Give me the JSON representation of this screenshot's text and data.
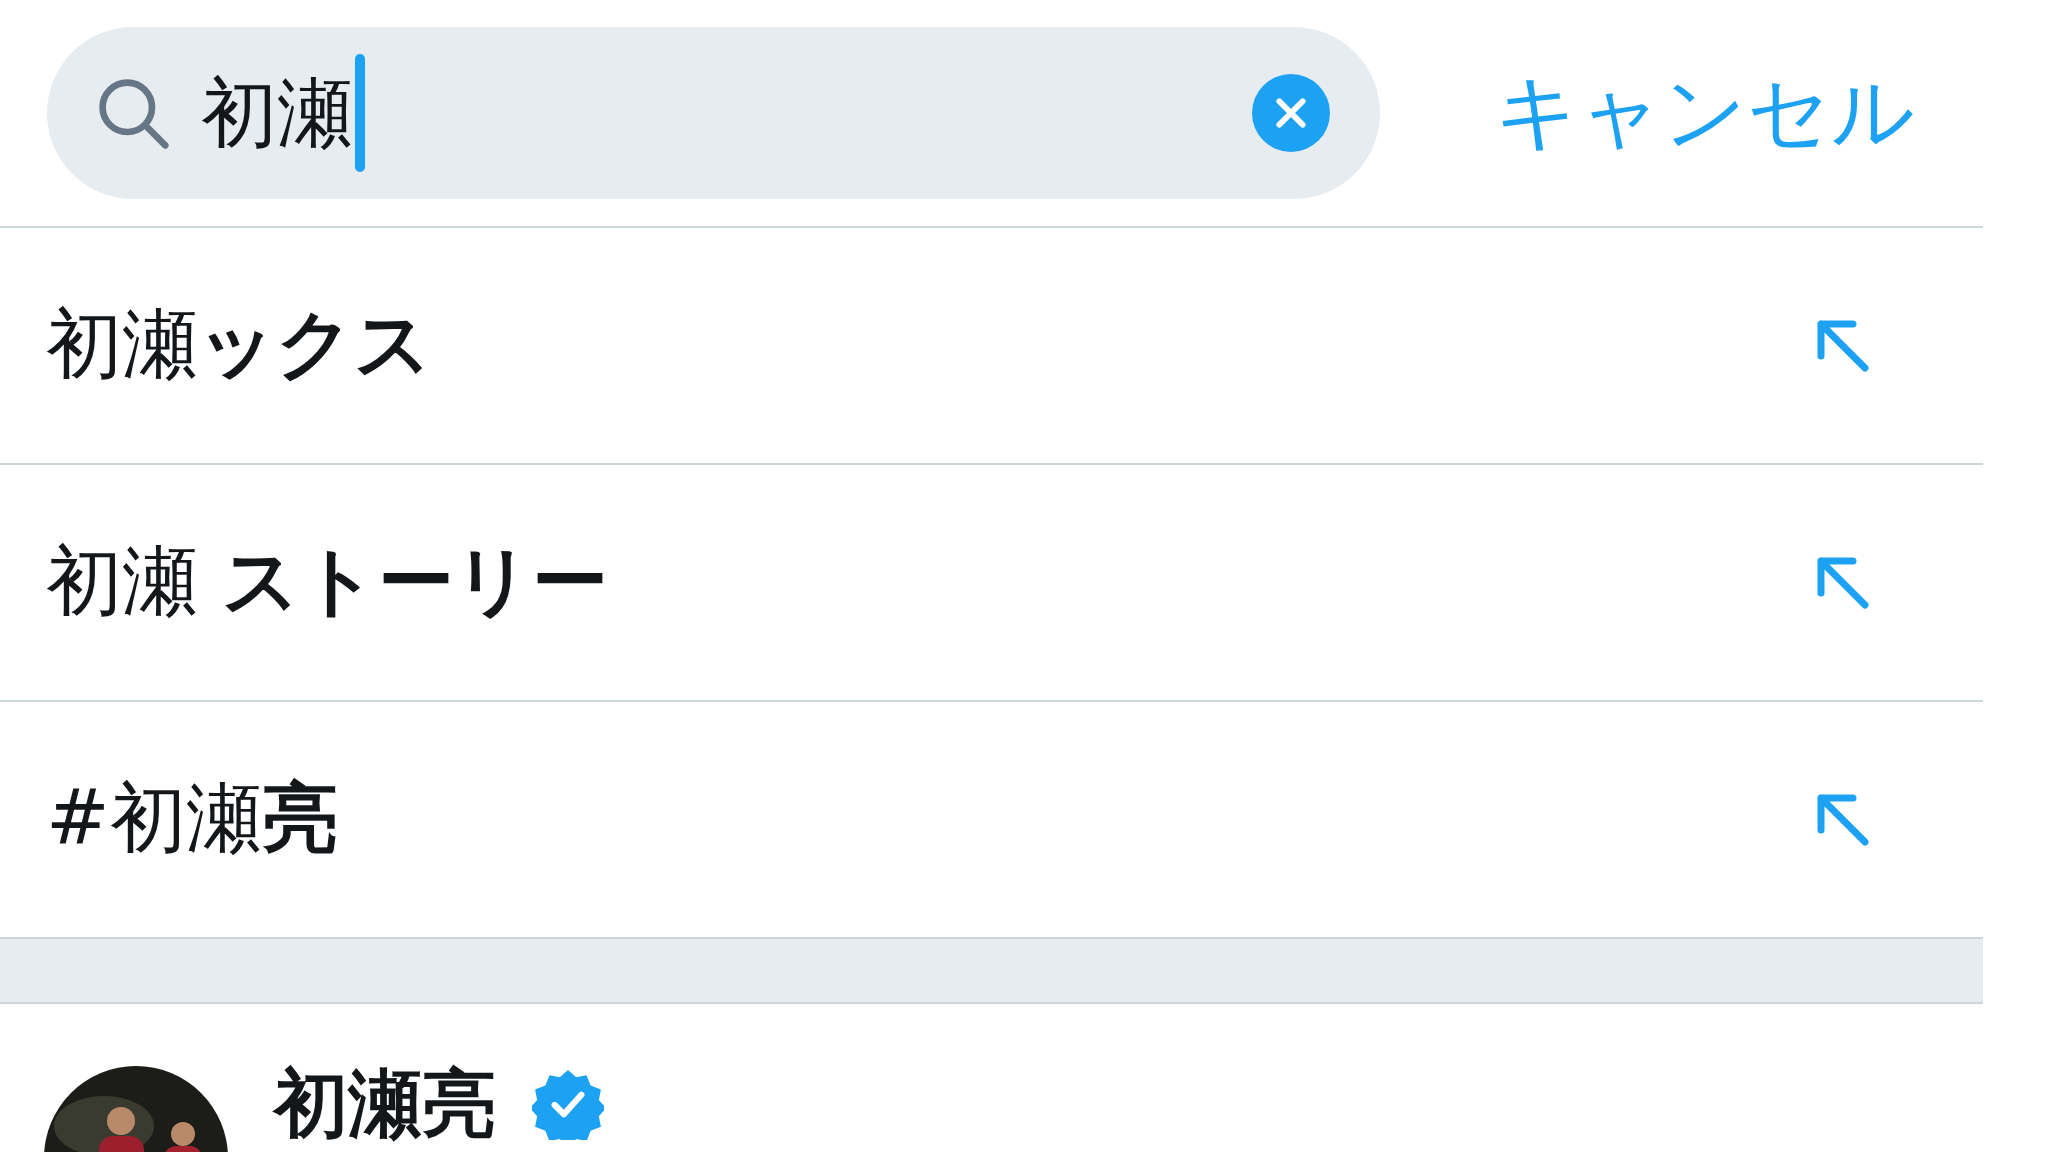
{
  "search": {
    "value": "初瀬",
    "cursor": true
  },
  "cancel": "キャンセル",
  "suggestions": [
    {
      "text": "初瀬**ックス**"
    },
    {
      "text": "初瀬 **ストーリー**"
    },
    {
      "text": "#初瀬**亮**"
    }
  ],
  "users": [
    {
      "name": "初瀬亮",
      "verified": true
    }
  ]
}
